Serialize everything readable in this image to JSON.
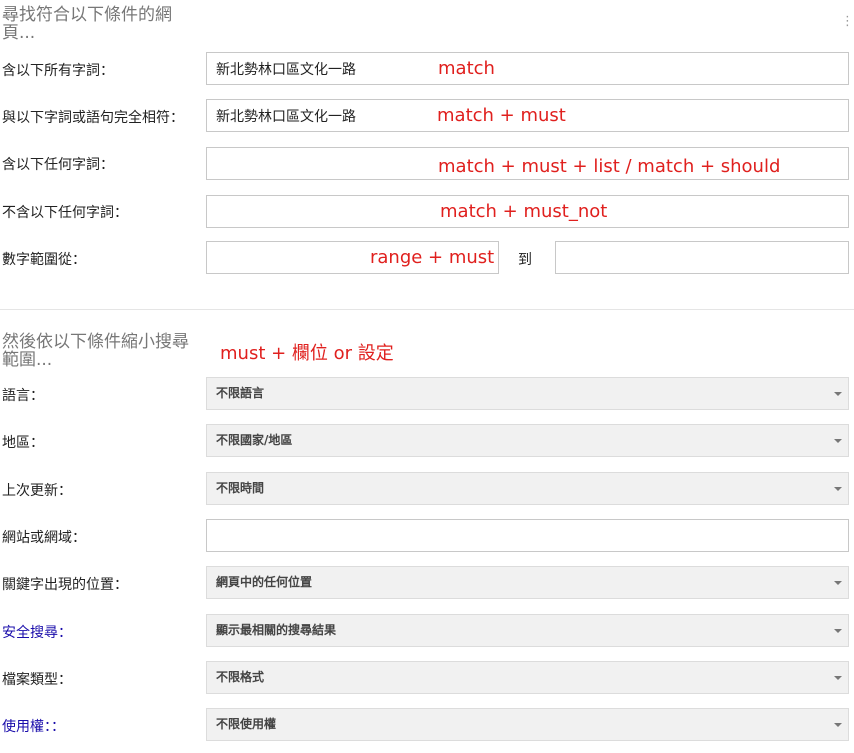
{
  "section1": {
    "title_line1": "尋找符合以下條件的網",
    "title_line2": "頁...",
    "corner_mark": "⋮"
  },
  "fields": [
    {
      "label": "含以下所有字詞：",
      "value": "新北勢林口區文化一路",
      "annotation": "match"
    },
    {
      "label": "與以下字詞或語句完全相符：",
      "value": "新北勢林口區文化一路",
      "annotation": "match + must"
    },
    {
      "label": "含以下任何字詞：",
      "value": "",
      "annotation": "match + must + list / match + should"
    },
    {
      "label": "不含以下任何字詞：",
      "value": "",
      "annotation": "match + must_not"
    }
  ],
  "range": {
    "label": "數字範圍從：",
    "to_label": "到",
    "from_value": "",
    "to_value": "",
    "annotation": "range + must"
  },
  "section2": {
    "title_line1": "然後依以下條件縮小搜尋",
    "title_line2": "範圍...",
    "annotation": "must + 欄位 or 設定"
  },
  "filters": [
    {
      "label": "語言：",
      "value": "不限語言"
    },
    {
      "label": "地區：",
      "value": "不限國家/地區"
    },
    {
      "label": "上次更新：",
      "value": "不限時間"
    },
    {
      "label": "網站或網域：",
      "value": ""
    },
    {
      "label": "關鍵字出現的位置：",
      "value": "網頁中的任何位置"
    },
    {
      "label": "安全搜尋：",
      "value": "顯示最相關的搜尋結果"
    },
    {
      "label": "檔案類型：",
      "value": "不限格式"
    },
    {
      "label": "使用權：：",
      "value": "不限使用權"
    }
  ],
  "colors": {
    "annotation": "#e0201e",
    "link_label": "#1a0dab"
  }
}
